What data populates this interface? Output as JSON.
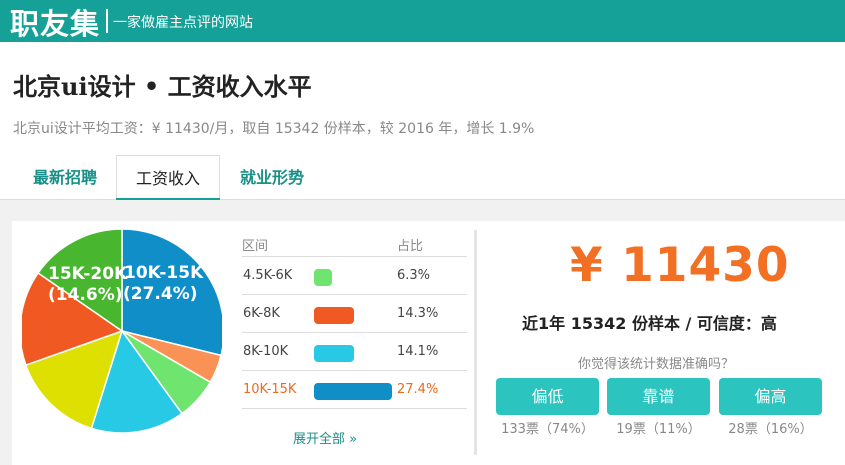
{
  "site": {
    "logo": "职友集",
    "slogan": "一家做雇主点评的网站"
  },
  "page": {
    "title": "北京ui设计 • 工资收入水平",
    "summary": "北京ui设计平均工资：¥ 11430/月，取自 15342 份样本，较 2016 年，增长 1.9%"
  },
  "tabs": [
    {
      "label": "最新招聘"
    },
    {
      "label": "工资收入"
    },
    {
      "label": "就业形势"
    }
  ],
  "colors": {
    "brand": "#15a098",
    "accent": "#f27024",
    "button": "#2bc4bf"
  },
  "chart_data": {
    "type": "pie",
    "slices": [
      {
        "label": "10K-15K",
        "value": 27.4,
        "color": "#0f8ec8",
        "shown_label": "10K-15K",
        "shown_pct": "(27.4%)"
      },
      {
        "label": "",
        "value": 4.3,
        "color": "#fa9256"
      },
      {
        "label": "4.5K-6K",
        "value": 6.3,
        "color": "#6fe46f"
      },
      {
        "label": "8K-10K",
        "value": 14.1,
        "color": "#28c9e4"
      },
      {
        "label": "",
        "value": 14.0,
        "color": "#dde000"
      },
      {
        "label": "6K-8K",
        "value": 14.3,
        "color": "#f05a22"
      },
      {
        "label": "15K-20K",
        "value": 14.6,
        "color": "#48b62e",
        "shown_label": "15K-20K",
        "shown_pct": "(14.6%)"
      }
    ]
  },
  "table": {
    "headers": [
      "区间",
      "占比"
    ],
    "rows": [
      {
        "range": "4.5K-6K",
        "percent": "6.3%",
        "value": 6.3,
        "color": "#6fe46f"
      },
      {
        "range": "6K-8K",
        "percent": "14.3%",
        "value": 14.3,
        "color": "#f05a22"
      },
      {
        "range": "8K-10K",
        "percent": "14.1%",
        "value": 14.1,
        "color": "#28c9e4"
      },
      {
        "range": "10K-15K",
        "percent": "27.4%",
        "value": 27.4,
        "color": "#0f8ec8",
        "highlight": true
      }
    ],
    "expand_label": "展开全部 »"
  },
  "salary": {
    "price": "¥ 11430",
    "sub": "近1年 15342 份样本 / 可信度：高",
    "question": "你觉得该统计数据准确吗？"
  },
  "votes": [
    {
      "label": "偏低",
      "count": "133票（74%）"
    },
    {
      "label": "靠谱",
      "count": "19票（11%）"
    },
    {
      "label": "偏高",
      "count": "28票（16%）"
    }
  ]
}
